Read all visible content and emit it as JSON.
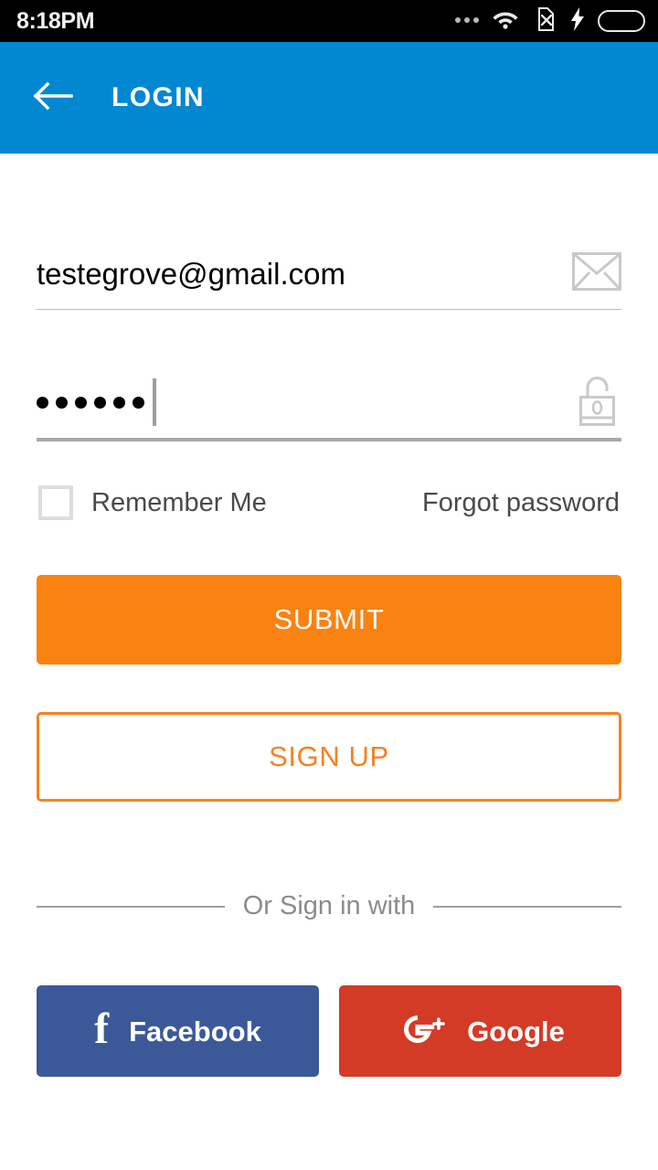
{
  "status_bar": {
    "time": "8:18PM",
    "icons": [
      {
        "name": "more-dots-icon",
        "label": "..."
      },
      {
        "name": "wifi-icon",
        "label": "wifi"
      },
      {
        "name": "no-sim-icon",
        "label": "no-sim"
      },
      {
        "name": "charging-bolt-icon",
        "label": "charging"
      },
      {
        "name": "battery-icon",
        "label": "battery-full"
      }
    ],
    "colors": {
      "background": "#000000",
      "battery_fill": "#33cc00",
      "text": "#f2f2f2"
    }
  },
  "app_bar": {
    "title": "LOGIN",
    "back_icon": "arrow-left-icon",
    "color": "#0288d1"
  },
  "form": {
    "email": {
      "value": "testegrove@gmail.com",
      "placeholder": "Email",
      "icon": "envelope-icon",
      "focused": false
    },
    "password": {
      "value": "••••••",
      "placeholder": "Password",
      "masked_length": 6,
      "icon": "unlocked-padlock-icon",
      "focused": true
    },
    "remember_me": {
      "label": "Remember Me",
      "checked": false
    },
    "forgot_password": {
      "label": "Forgot password"
    },
    "submit_button": {
      "label": "SUBMIT",
      "color": "#fa8210"
    },
    "signup_button": {
      "label": "SIGN UP",
      "color": "#f58220"
    }
  },
  "divider": {
    "label": "Or Sign in with"
  },
  "social": {
    "facebook": {
      "label": "Facebook",
      "icon": "facebook-f-icon",
      "color": "#3b5998"
    },
    "google": {
      "label": "Google",
      "icon": "google-plus-icon",
      "color": "#d33b27"
    }
  }
}
